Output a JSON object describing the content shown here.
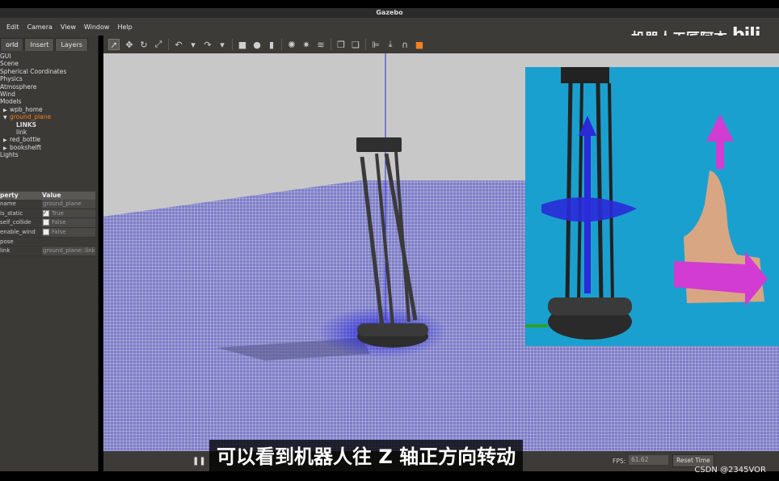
{
  "window": {
    "title": "Gazebo"
  },
  "menu": [
    "Edit",
    "Camera",
    "View",
    "Window",
    "Help"
  ],
  "brand": {
    "text": "机器人工匠阿杰",
    "logo": "bilibili-logo"
  },
  "left_panel": {
    "tabs": [
      "orld",
      "Insert",
      "Layers"
    ],
    "tree": [
      {
        "label": "GUI",
        "level": 0
      },
      {
        "label": "Scene",
        "level": 0
      },
      {
        "label": "Spherical Coordinates",
        "level": 0
      },
      {
        "label": "Physics",
        "level": 0
      },
      {
        "label": "Atmosphere",
        "level": 0
      },
      {
        "label": "Wind",
        "level": 0
      },
      {
        "label": "Models",
        "level": 0
      },
      {
        "label": "wpb_home",
        "level": 1,
        "arrow": "right"
      },
      {
        "label": "ground_plane",
        "level": 1,
        "arrow": "down",
        "selected": true
      },
      {
        "label": "LINKS",
        "level": 2
      },
      {
        "label": "link",
        "level": 2
      },
      {
        "label": "red_bottle",
        "level": 1,
        "arrow": "right"
      },
      {
        "label": "bookshelft",
        "level": 1,
        "arrow": "right"
      },
      {
        "label": "Lights",
        "level": 0
      }
    ],
    "properties": {
      "header": {
        "key": "perty",
        "value": "Value"
      },
      "rows": [
        {
          "key": "name",
          "value": "ground_plane"
        },
        {
          "key": "is_static",
          "value": "True",
          "checked": true
        },
        {
          "key": "self_collide",
          "value": "False",
          "checked": false
        },
        {
          "key": "enable_wind",
          "value": "False",
          "checked": false
        },
        {
          "key": "pose",
          "value": ""
        },
        {
          "key": "link",
          "value": "ground_plane::link"
        }
      ]
    }
  },
  "toolbar_icons": [
    "select-arrow-icon",
    "translate-icon",
    "rotate-icon",
    "scale-icon",
    "undo-icon",
    "undo-dropdown-icon",
    "redo-icon",
    "redo-dropdown-icon",
    "box-icon",
    "sphere-icon",
    "cylinder-icon",
    "pointlight-icon",
    "spotlight-icon",
    "directionallight-icon",
    "copy-icon",
    "paste-icon",
    "align-icon",
    "snap-icon",
    "magnet-icon",
    "screenshot-icon"
  ],
  "bottom_bar": {
    "fps_label": "FPS:",
    "fps_value": "61.62",
    "reset_label": "Reset Time"
  },
  "subtitle": "可以看到机器人往 Z 轴正方向转动",
  "watermark": "CSDN @2345VOR",
  "colors": {
    "floor": "#7e7ec8",
    "accent": "#f08020",
    "overlay_bg": "#1aa0cf",
    "arrow_blue": "#2a2ad8",
    "arrow_magenta": "#d23cd2"
  }
}
